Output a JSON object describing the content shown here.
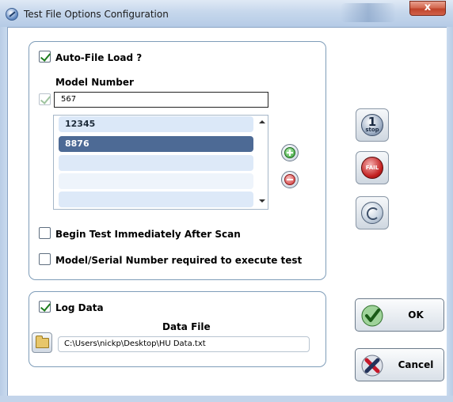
{
  "window": {
    "title": "Test File Options Configuration",
    "close_label": "x"
  },
  "auto_file_group": {
    "auto_file_load": {
      "label": "Auto-File Load ?",
      "checked": true
    },
    "model_number": {
      "heading": "Model Number",
      "enabled_checked": true,
      "value": "567"
    },
    "model_list": {
      "items": [
        "12345",
        "8876",
        "",
        "",
        ""
      ],
      "selected_index": 1
    },
    "begin_test": {
      "label": "Begin Test Immediately After Scan",
      "checked": false
    },
    "serial_required": {
      "label": "Model/Serial Number required to execute test",
      "checked": false
    }
  },
  "log_group": {
    "log_data": {
      "label": "Log Data",
      "checked": true
    },
    "data_file": {
      "heading": "Data File",
      "path": "C:\\Users\\nickp\\Desktop\\HU Data.txt"
    }
  },
  "side_buttons": {
    "stop_one": {
      "icon": "stop-1-icon",
      "number": "1",
      "word": "stop"
    },
    "fail": {
      "icon": "fail-stop-icon",
      "word": "FAIL"
    },
    "cycle": {
      "icon": "cycle-icon"
    }
  },
  "actions": {
    "ok_label": "OK",
    "cancel_label": "Cancel"
  },
  "colors": {
    "accent_selected": "#4d6a95",
    "list_item": "#dbe8f8",
    "group_border": "#7f9db9",
    "check_green": "#1e7d1e",
    "close_red": "#c0432a"
  }
}
